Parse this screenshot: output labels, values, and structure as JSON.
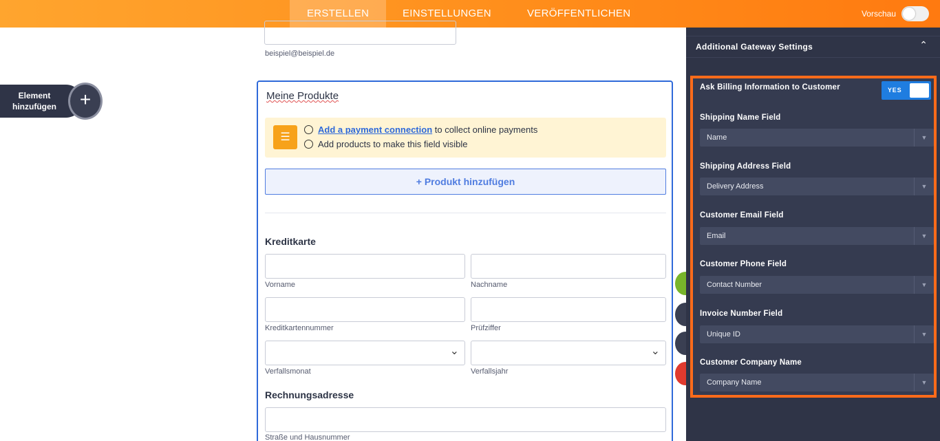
{
  "topbar": {
    "tabs": [
      {
        "label": "ERSTELLEN"
      },
      {
        "label": "EINSTELLUNGEN"
      },
      {
        "label": "VERÖFFENTLICHEN"
      }
    ],
    "preview_label": "Vorschau"
  },
  "left": {
    "add_element_label": "Element hinzufügen"
  },
  "form": {
    "email_hint": "beispiel@beispiel.de",
    "widget_title": "Meine Produkte",
    "notice": {
      "link_text": "Add a payment connection",
      "line1_rest": " to collect online payments",
      "line2": "Add products to make this field visible"
    },
    "add_product_label": "+ Produkt hinzufügen",
    "credit_card": {
      "heading": "Kreditkarte",
      "first_name": "Vorname",
      "last_name": "Nachname",
      "card_number": "Kreditkartennummer",
      "cvv": "Prüfziffer",
      "exp_month": "Verfallsmonat",
      "exp_year": "Verfallsjahr"
    },
    "billing": {
      "heading": "Rechnungsadresse",
      "street": "Straße und Hausnummer"
    }
  },
  "panel": {
    "title": "Additional Gateway Settings",
    "ask_billing_label": "Ask Billing Information to Customer",
    "ask_billing_toggle": "YES",
    "fields": [
      {
        "label": "Shipping Name Field",
        "value": "Name"
      },
      {
        "label": "Shipping Address Field",
        "value": "Delivery Address"
      },
      {
        "label": "Customer Email Field",
        "value": "Email"
      },
      {
        "label": "Customer Phone Field",
        "value": "Contact Number"
      },
      {
        "label": "Invoice Number Field",
        "value": "Unique ID"
      },
      {
        "label": "Customer Company Name",
        "value": "Company Name"
      }
    ],
    "highlight_color": "#ff6b1a"
  }
}
